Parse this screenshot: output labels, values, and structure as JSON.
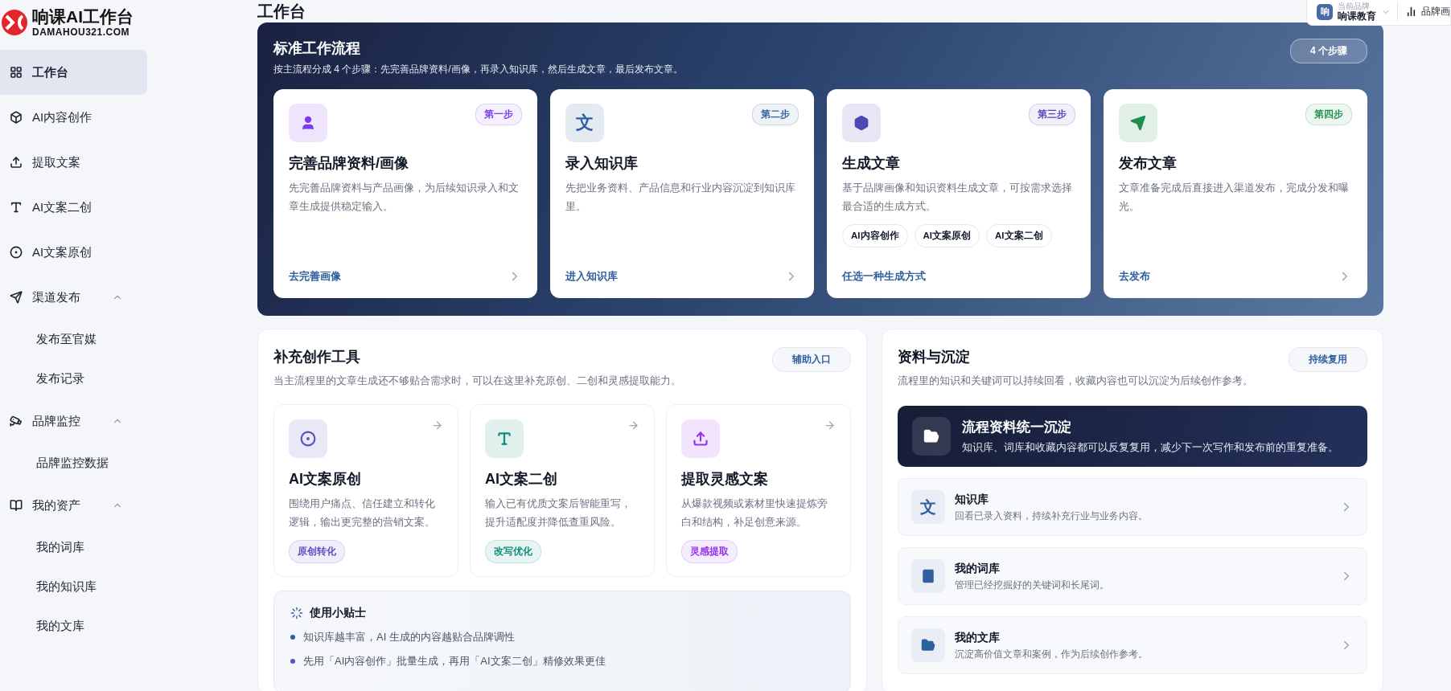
{
  "brand": {
    "name": "响课AI工作台",
    "domain": "DAMAHOU321.COM"
  },
  "sidebar": {
    "items": [
      {
        "label": "工作台",
        "selected": true
      },
      {
        "label": "AI内容创作",
        "selected": false
      },
      {
        "label": "提取文案",
        "selected": false
      },
      {
        "label": "AI文案二创",
        "selected": false
      },
      {
        "label": "AI文案原创",
        "selected": false
      },
      {
        "label": "渠道发布",
        "selected": false,
        "expanded": true,
        "children": [
          {
            "label": "发布至官媒",
            "selected": false
          },
          {
            "label": "发布记录",
            "selected": false
          }
        ]
      },
      {
        "label": "品牌监控",
        "selected": false,
        "expanded": true,
        "children": [
          {
            "label": "品牌监控数据",
            "selected": false
          }
        ]
      },
      {
        "label": "我的资产",
        "selected": false,
        "expanded": true,
        "children": [
          {
            "label": "我的词库",
            "selected": false
          },
          {
            "label": "我的知识库",
            "selected": false
          },
          {
            "label": "我的文库",
            "selected": false
          }
        ]
      }
    ]
  },
  "header": {
    "brand_switch": {
      "avatar": "响",
      "caption": "当前品牌",
      "value": "响课教育",
      "expanded": false
    },
    "link": "品牌画"
  },
  "page_title": "工作台",
  "flow": {
    "title": "标准工作流程",
    "subtitle": "按主流程分成 4 个步骤：先完善品牌资料/画像，再录入知识库，然后生成文章，最后发布文章。",
    "badge": "4 个步骤",
    "steps": [
      {
        "step": "第一步",
        "color": "#7c3aed",
        "title": "完善品牌资料/画像",
        "description": "先完善品牌资料与产品画像，为后续知识录入和文章生成提供稳定输入。",
        "link": "去完善画像"
      },
      {
        "step": "第二步",
        "color": "#2f5f9e",
        "glyph": "文",
        "title": "录入知识库",
        "description": "先把业务资料、产品信息和行业内容沉淀到知识库里。",
        "link": "进入知识库"
      },
      {
        "step": "第三步",
        "color": "#4f46b5",
        "title": "生成文章",
        "description": "基于品牌画像和知识资料生成文章，可按需求选择最合适的生成方式。",
        "options": [
          "AI内容创作",
          "AI文案原创",
          "AI文案二创"
        ],
        "link": "任选一种生成方式"
      },
      {
        "step": "第四步",
        "color": "#1f8f4e",
        "title": "发布文章",
        "description": "文章准备完成后直接进入渠道发布，完成分发和曝光。",
        "link": "去发布"
      }
    ]
  },
  "tools": {
    "title": "补充创作工具",
    "subtitle": "当主流程里的文章生成还不够贴合需求时，可以在这里补充原创、二创和灵感提取能力。",
    "badge": "辅助入口",
    "cards": [
      {
        "title": "AI文案原创",
        "color": "#5b4fc4",
        "description": "围绕用户痛点、信任建立和转化逻辑，输出更完整的营销文案。",
        "tag": "原创转化"
      },
      {
        "title": "AI文案二创",
        "color": "#0f8f7a",
        "description": "输入已有优质文案后智能重写，提升适配度并降低查重风险。",
        "tag": "改写优化"
      },
      {
        "title": "提取灵感文案",
        "color": "#9333ea",
        "description": "从爆款视频或素材里快速提炼旁白和结构，补足创意来源。",
        "tag": "灵感提取"
      }
    ],
    "tips": {
      "title": "使用小贴士",
      "items": [
        {
          "text": "知识库越丰富，AI 生成的内容越贴合品牌调性",
          "color": "#2f5f9e"
        },
        {
          "text": "先用「AI内容创作」批量生成，再用「AI文案二创」精修效果更佳",
          "color": "#5b4fc4"
        }
      ]
    }
  },
  "assets": {
    "title": "资料与沉淀",
    "subtitle": "流程里的知识和关键词可以持续回看，收藏内容也可以沉淀为后续创作参考。",
    "badge": "持续复用",
    "highlight": {
      "title": "流程资料统一沉淀",
      "description": "知识库、词库和收藏内容都可以反复复用，减少下一次写作和发布前的重复准备。"
    },
    "items": [
      {
        "title": "知识库",
        "glyph": "文",
        "description": "回看已录入资料，持续补充行业与业务内容。"
      },
      {
        "title": "我的词库",
        "description": "管理已经挖掘好的关键词和长尾词。"
      },
      {
        "title": "我的文库",
        "description": "沉淀高价值文章和案例，作为后续创作参考。"
      }
    ]
  }
}
